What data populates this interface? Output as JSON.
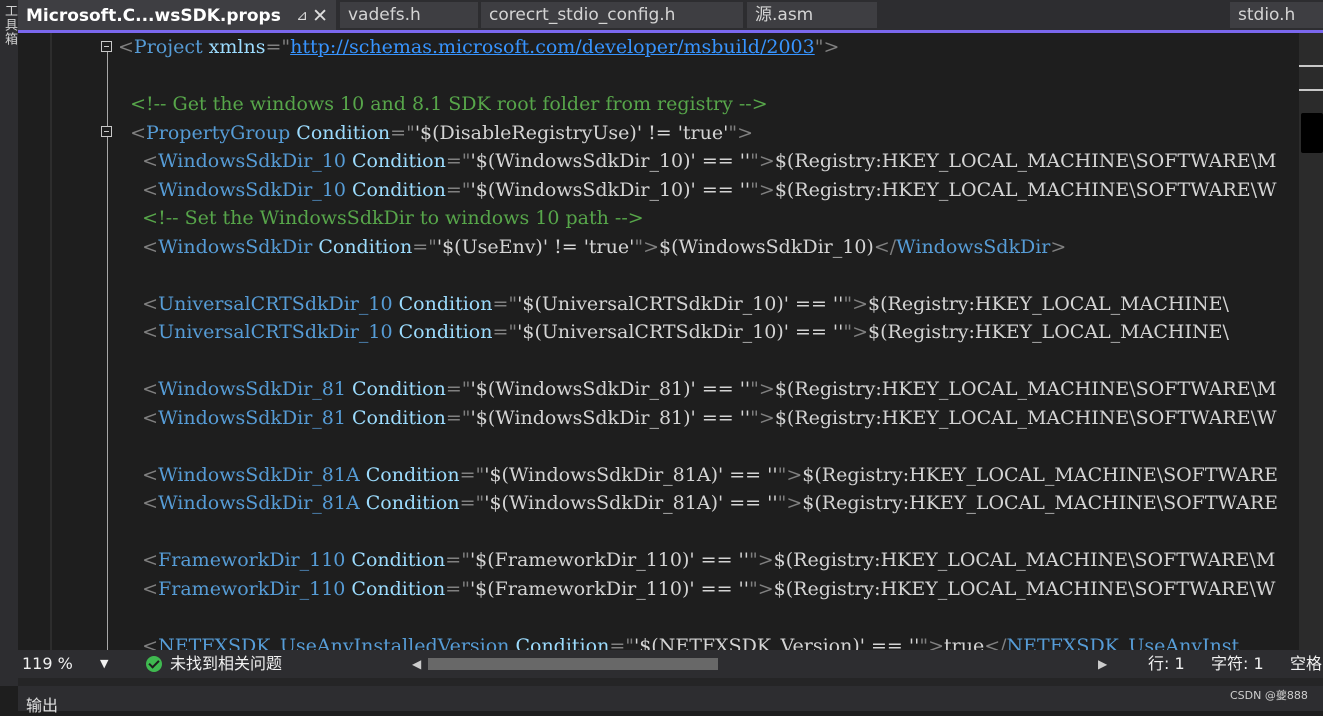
{
  "left_panel": {
    "vertical_label": "工具箱"
  },
  "tabs": [
    {
      "label": "Microsoft.C...wsSDK.props",
      "pin_icon": "pin-icon",
      "close_icon": "close-icon",
      "active": true
    },
    {
      "label": "vadefs.h"
    },
    {
      "label": "corecrt_stdio_config.h"
    },
    {
      "label": "源.asm"
    },
    {
      "label": "stdio.h"
    }
  ],
  "code_lines": [
    [
      [
        "delim",
        "<"
      ],
      [
        "tag",
        "Project"
      ],
      [
        "attr",
        " xmlns"
      ],
      [
        "delim",
        "=\""
      ],
      [
        "url",
        "http://schemas.microsoft.com/developer/msbuild/2003"
      ],
      [
        "delim",
        "\">"
      ]
    ],
    [],
    [
      [
        "cmt",
        "  <!-- Get the windows 10 and 8.1 SDK root folder from registry -->"
      ]
    ],
    [
      [
        "delim",
        "  <"
      ],
      [
        "tag",
        "PropertyGroup"
      ],
      [
        "attr",
        " Condition"
      ],
      [
        "delim",
        "=\""
      ],
      [
        "val",
        "'$(DisableRegistryUse)' != 'true'"
      ],
      [
        "delim",
        "\">"
      ]
    ],
    [
      [
        "delim",
        "    <"
      ],
      [
        "tag",
        "WindowsSdkDir_10"
      ],
      [
        "attr",
        " Condition"
      ],
      [
        "delim",
        "=\""
      ],
      [
        "val",
        "'$(WindowsSdkDir_10)' == ''"
      ],
      [
        "delim",
        "\">"
      ],
      [
        "txt",
        "$(Registry:HKEY_LOCAL_MACHINE\\SOFTWARE\\M"
      ]
    ],
    [
      [
        "delim",
        "    <"
      ],
      [
        "tag",
        "WindowsSdkDir_10"
      ],
      [
        "attr",
        " Condition"
      ],
      [
        "delim",
        "=\""
      ],
      [
        "val",
        "'$(WindowsSdkDir_10)' == ''"
      ],
      [
        "delim",
        "\">"
      ],
      [
        "txt",
        "$(Registry:HKEY_LOCAL_MACHINE\\SOFTWARE\\W"
      ]
    ],
    [
      [
        "cmt",
        "    <!-- Set the WindowsSdkDir to windows 10 path -->"
      ]
    ],
    [
      [
        "delim",
        "    <"
      ],
      [
        "tag",
        "WindowsSdkDir"
      ],
      [
        "attr",
        " Condition"
      ],
      [
        "delim",
        "=\""
      ],
      [
        "val",
        "'$(UseEnv)' != 'true'"
      ],
      [
        "delim",
        "\">"
      ],
      [
        "txt",
        "$(WindowsSdkDir_10)"
      ],
      [
        "delim",
        "</"
      ],
      [
        "tag",
        "WindowsSdkDir"
      ],
      [
        "delim",
        ">"
      ]
    ],
    [],
    [
      [
        "delim",
        "    <"
      ],
      [
        "tag",
        "UniversalCRTSdkDir_10"
      ],
      [
        "attr",
        " Condition"
      ],
      [
        "delim",
        "=\""
      ],
      [
        "val",
        "'$(UniversalCRTSdkDir_10)' == ''"
      ],
      [
        "delim",
        "\">"
      ],
      [
        "txt",
        "$(Registry:HKEY_LOCAL_MACHINE\\"
      ]
    ],
    [
      [
        "delim",
        "    <"
      ],
      [
        "tag",
        "UniversalCRTSdkDir_10"
      ],
      [
        "attr",
        " Condition"
      ],
      [
        "delim",
        "=\""
      ],
      [
        "val",
        "'$(UniversalCRTSdkDir_10)' == ''"
      ],
      [
        "delim",
        "\">"
      ],
      [
        "txt",
        "$(Registry:HKEY_LOCAL_MACHINE\\"
      ]
    ],
    [],
    [
      [
        "delim",
        "    <"
      ],
      [
        "tag",
        "WindowsSdkDir_81"
      ],
      [
        "attr",
        " Condition"
      ],
      [
        "delim",
        "=\""
      ],
      [
        "val",
        "'$(WindowsSdkDir_81)' == ''"
      ],
      [
        "delim",
        "\">"
      ],
      [
        "txt",
        "$(Registry:HKEY_LOCAL_MACHINE\\SOFTWARE\\M"
      ]
    ],
    [
      [
        "delim",
        "    <"
      ],
      [
        "tag",
        "WindowsSdkDir_81"
      ],
      [
        "attr",
        " Condition"
      ],
      [
        "delim",
        "=\""
      ],
      [
        "val",
        "'$(WindowsSdkDir_81)' == ''"
      ],
      [
        "delim",
        "\">"
      ],
      [
        "txt",
        "$(Registry:HKEY_LOCAL_MACHINE\\SOFTWARE\\W"
      ]
    ],
    [],
    [
      [
        "delim",
        "    <"
      ],
      [
        "tag",
        "WindowsSdkDir_81A"
      ],
      [
        "attr",
        " Condition"
      ],
      [
        "delim",
        "=\""
      ],
      [
        "val",
        "'$(WindowsSdkDir_81A)' == ''"
      ],
      [
        "delim",
        "\">"
      ],
      [
        "txt",
        "$(Registry:HKEY_LOCAL_MACHINE\\SOFTWARE"
      ]
    ],
    [
      [
        "delim",
        "    <"
      ],
      [
        "tag",
        "WindowsSdkDir_81A"
      ],
      [
        "attr",
        " Condition"
      ],
      [
        "delim",
        "=\""
      ],
      [
        "val",
        "'$(WindowsSdkDir_81A)' == ''"
      ],
      [
        "delim",
        "\">"
      ],
      [
        "txt",
        "$(Registry:HKEY_LOCAL_MACHINE\\SOFTWARE"
      ]
    ],
    [],
    [
      [
        "delim",
        "    <"
      ],
      [
        "tag",
        "FrameworkDir_110"
      ],
      [
        "attr",
        " Condition"
      ],
      [
        "delim",
        "=\""
      ],
      [
        "val",
        "'$(FrameworkDir_110)' == ''"
      ],
      [
        "delim",
        "\">"
      ],
      [
        "txt",
        "$(Registry:HKEY_LOCAL_MACHINE\\SOFTWARE\\M"
      ]
    ],
    [
      [
        "delim",
        "    <"
      ],
      [
        "tag",
        "FrameworkDir_110"
      ],
      [
        "attr",
        " Condition"
      ],
      [
        "delim",
        "=\""
      ],
      [
        "val",
        "'$(FrameworkDir_110)' == ''"
      ],
      [
        "delim",
        "\">"
      ],
      [
        "txt",
        "$(Registry:HKEY_LOCAL_MACHINE\\SOFTWARE\\W"
      ]
    ],
    [],
    [
      [
        "delim",
        "    <"
      ],
      [
        "tag",
        "NETFXSDK_UseAnyInstalledVersion"
      ],
      [
        "attr",
        " Condition"
      ],
      [
        "delim",
        "=\""
      ],
      [
        "val",
        "'$(NETFXSDK_Version)' == ''"
      ],
      [
        "delim",
        "\">"
      ],
      [
        "txt",
        "true"
      ],
      [
        "delim",
        "</"
      ],
      [
        "tag",
        "NETFXSDK_UseAnyInst"
      ]
    ]
  ],
  "status": {
    "zoom": "119 %",
    "issues_icon": "check-circle-icon",
    "issues": "未找到相关问题",
    "line": "行: 1",
    "char": "字符: 1",
    "space": "空格"
  },
  "output": {
    "title": "输出"
  },
  "watermark": "CSDN @夔888",
  "colors": {
    "accent": "#7b68ee",
    "tag": "#569cd6",
    "attr": "#9cdcfe",
    "comment": "#57a64a",
    "url": "#3794ff"
  }
}
